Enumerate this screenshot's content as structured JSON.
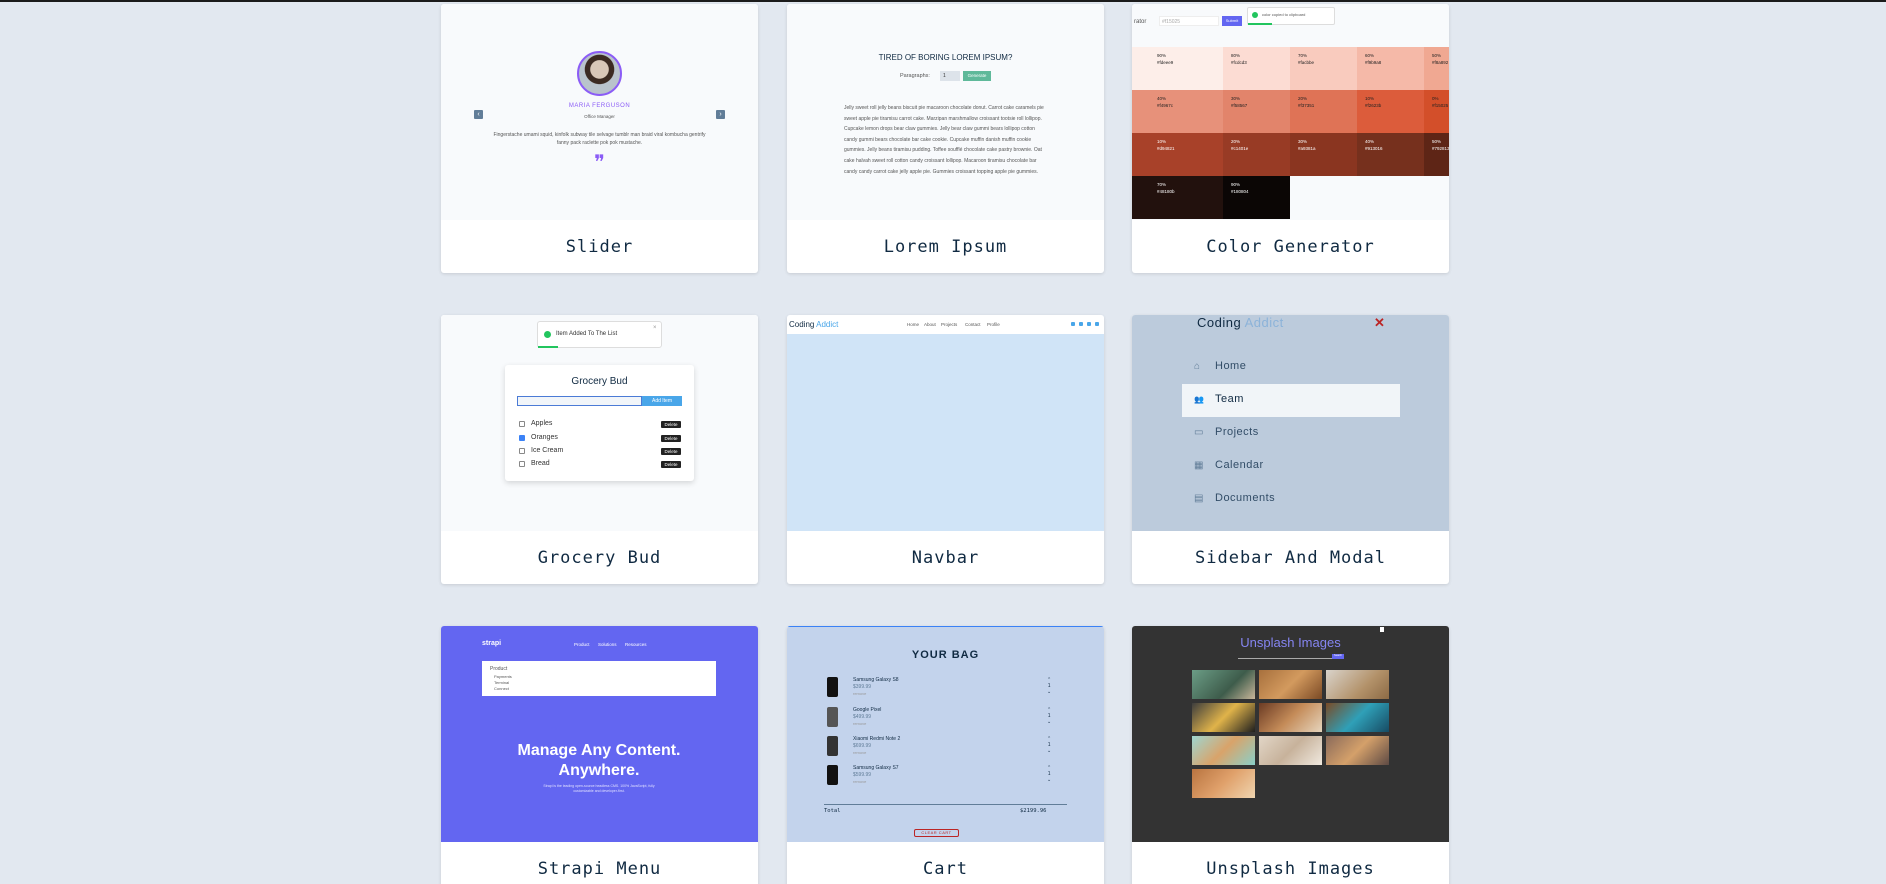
{
  "cards": [
    {
      "title": "Slider"
    },
    {
      "title": "Lorem Ipsum"
    },
    {
      "title": "Color Generator"
    },
    {
      "title": "Grocery Bud"
    },
    {
      "title": "Navbar"
    },
    {
      "title": "Sidebar And Modal"
    },
    {
      "title": "Strapi Menu"
    },
    {
      "title": "Cart"
    },
    {
      "title": "Unsplash Images"
    }
  ],
  "slider": {
    "name": "MARIA FERGUSON",
    "job": "Office Manager",
    "quote": "Fingerstache umami squid, kinfolk subway tile selvage tumblr man braid viral kombucha gentrify fanny pack raclette pok pok mustache.",
    "prev": "‹",
    "next": "›",
    "quote_glyph": "❞",
    "accent": "#8b5cf6"
  },
  "lorem": {
    "heading": "TIRED OF BORING LOREM IPSUM?",
    "label": "Paragraphs:",
    "value": "1",
    "button": "Generate",
    "paragraph": "Jelly sweet roll jelly beans biscuit pie macaroon chocolate donut. Carrot cake caramels pie sweet apple pie tiramisu carrot cake. Marzipan marshmallow croissant tootsie roll lollipop. Cupcake lemon drops bear claw gummies. Jelly bear claw gummi bears lollipop cotton candy gummi bears chocolate bar cake cookie. Cupcake muffin danish muffin cookie gummies. Jelly beans tiramisu pudding. Toffee soufflé chocolate cake pastry brownie. Oat cake halvah sweet roll cotton candy croissant lollipop. Macaroon tiramisu chocolate bar candy candy carrot cake jelly apple pie. Gummies croissant topping apple pie gummies."
  },
  "colors": {
    "label": "rator",
    "input": "#f15025",
    "button": "Submit",
    "toast": "color copied to clipboard",
    "swatches": [
      {
        "pct": "90%",
        "hex": "#fdeee9",
        "bg": "#fdeee9"
      },
      {
        "pct": "80%",
        "hex": "#fcdcd3",
        "bg": "#fcdcd3"
      },
      {
        "pct": "70%",
        "hex": "#facbbe",
        "bg": "#f9cbbe"
      },
      {
        "pct": "60%",
        "hex": "#f9b9a8",
        "bg": "#f5b9a8"
      },
      {
        "pct": "50%",
        "hex": "#f8a892",
        "bg": "#f0a892"
      },
      {
        "pct": "40%",
        "hex": "#f4967c",
        "bg": "#e7917a"
      },
      {
        "pct": "30%",
        "hex": "#f58567",
        "bg": "#e2846b"
      },
      {
        "pct": "20%",
        "hex": "#f37351",
        "bg": "#df7356"
      },
      {
        "pct": "10%",
        "hex": "#f2623b",
        "bg": "#dc5c3b"
      },
      {
        "pct": "0%",
        "hex": "#f15025",
        "bg": "#d34f2a"
      },
      {
        "pct": "10%",
        "hex": "#d94821",
        "bg": "#a84129"
      },
      {
        "pct": "20%",
        "hex": "#c1401e",
        "bg": "#983b25"
      },
      {
        "pct": "30%",
        "hex": "#a9381a",
        "bg": "#8a3520"
      },
      {
        "pct": "40%",
        "hex": "#913016",
        "bg": "#76301d"
      },
      {
        "pct": "50%",
        "hex": "#792813",
        "bg": "#5e2516"
      },
      {
        "pct": "60%",
        "hex": "#60200f",
        "bg": "#3a1a12"
      },
      {
        "pct": "70%",
        "hex": "#48180b",
        "bg": "#22110d"
      },
      {
        "pct": "80%",
        "hex": "#301007",
        "bg": "#150c09"
      },
      {
        "pct": "90%",
        "hex": "#180804",
        "bg": "#0b0605"
      }
    ]
  },
  "grocery": {
    "toast": "Item Added To The List",
    "heading": "Grocery Bud",
    "button": "Add Item",
    "delete": "Delete",
    "items": [
      {
        "name": "Apples"
      },
      {
        "name": "Oranges"
      },
      {
        "name": "Ice Cream"
      },
      {
        "name": "Bread"
      }
    ]
  },
  "navbar": {
    "logo_a": "Coding",
    "logo_b": "Addict",
    "links": [
      "Home",
      "About",
      "Projects",
      "Contact",
      "Profile"
    ]
  },
  "sidebar": {
    "logo_a": "Coding",
    "logo_b": "Addict",
    "close": "✕",
    "items": [
      {
        "label": "Home",
        "icon": "⌂"
      },
      {
        "label": "Team",
        "icon": "👥"
      },
      {
        "label": "Projects",
        "icon": "▭"
      },
      {
        "label": "Calendar",
        "icon": "▦"
      },
      {
        "label": "Documents",
        "icon": "▤"
      }
    ]
  },
  "strapi": {
    "logo": "strapi",
    "links": [
      "Product",
      "Solutions",
      "Resources"
    ],
    "menu_title": "Product",
    "menu_items": [
      "Payments",
      "Terminal",
      "Connect"
    ],
    "hero": "Manage Any Content. Anywhere.",
    "sub": "Strapi is the leading open-source headless CMS. 100% JavaScript, fully customizable and developer-first."
  },
  "cart": {
    "heading": "YOUR BAG",
    "items": [
      {
        "name": "Samsung Galaxy S8",
        "price": "$399.99",
        "remove": "remove",
        "qty": "1"
      },
      {
        "name": "Google Pixel",
        "price": "$499.99",
        "remove": "remove",
        "qty": "1"
      },
      {
        "name": "Xiaomi Redmi Note 2",
        "price": "$699.99",
        "remove": "remove",
        "qty": "1"
      },
      {
        "name": "Samsung Galaxy S7",
        "price": "$599.99",
        "remove": "remove",
        "qty": "1"
      }
    ],
    "total_label": "Total",
    "total": "$2199.96",
    "clear": "CLEAR CART"
  },
  "unsplash": {
    "heading": "Unsplash Images",
    "button": "Search"
  }
}
